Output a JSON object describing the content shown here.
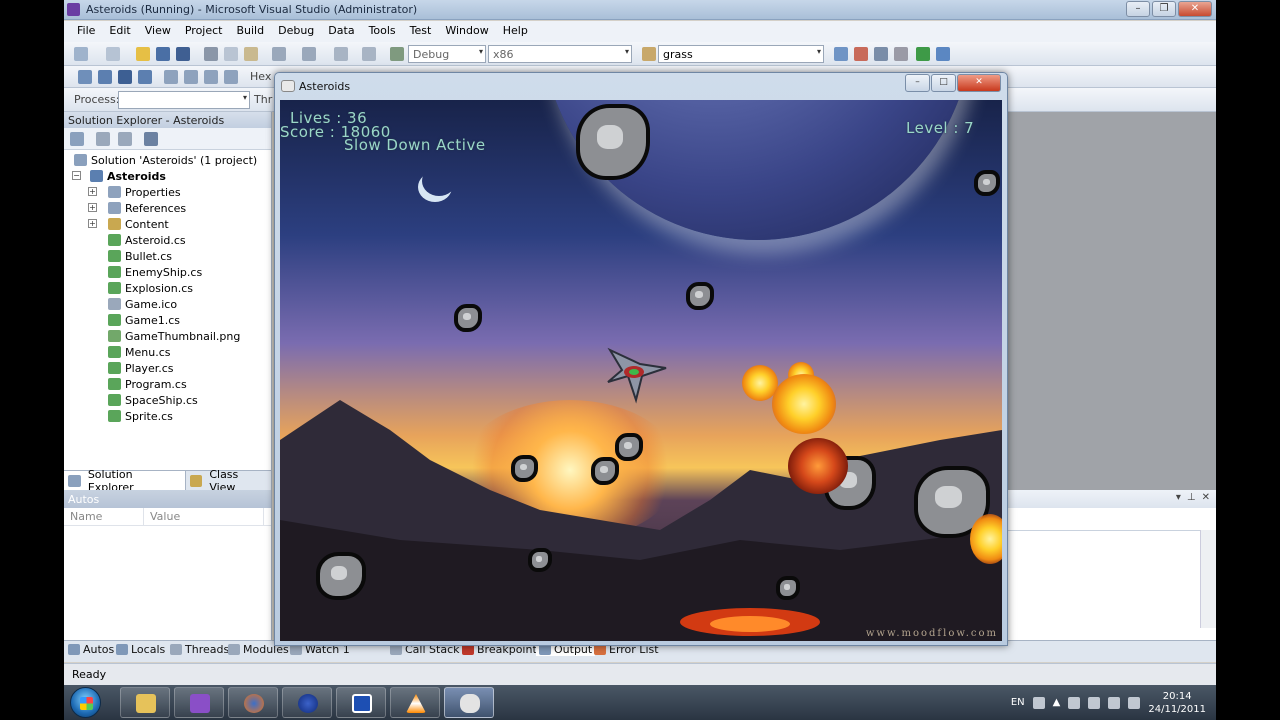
{
  "window": {
    "title": "Asteroids (Running) - Microsoft Visual Studio (Administrator)"
  },
  "menu": [
    "File",
    "Edit",
    "View",
    "Project",
    "Build",
    "Debug",
    "Data",
    "Tools",
    "Test",
    "Window",
    "Help"
  ],
  "toolbar": {
    "config": "Debug",
    "platform": "x86",
    "find": "grass",
    "hex_label": "Hex",
    "process_label": "Process:",
    "thread_label": "Thr"
  },
  "solution_explorer": {
    "title": "Solution Explorer - Asteroids",
    "solution": "Solution 'Asteroids' (1 project)",
    "project": "Asteroids",
    "items": [
      {
        "label": "Properties",
        "icon": "folder-icon"
      },
      {
        "label": "References",
        "icon": "folder-icon"
      },
      {
        "label": "Content",
        "icon": "content-icon"
      },
      {
        "label": "Asteroid.cs",
        "icon": "cs-file-icon"
      },
      {
        "label": "Bullet.cs",
        "icon": "cs-file-icon"
      },
      {
        "label": "EnemyShip.cs",
        "icon": "cs-file-icon"
      },
      {
        "label": "Explosion.cs",
        "icon": "cs-file-icon"
      },
      {
        "label": "Game.ico",
        "icon": "ico-file-icon"
      },
      {
        "label": "Game1.cs",
        "icon": "cs-file-icon"
      },
      {
        "label": "GameThumbnail.png",
        "icon": "image-file-icon"
      },
      {
        "label": "Menu.cs",
        "icon": "cs-file-icon"
      },
      {
        "label": "Player.cs",
        "icon": "cs-file-icon"
      },
      {
        "label": "Program.cs",
        "icon": "cs-file-icon"
      },
      {
        "label": "SpaceShip.cs",
        "icon": "cs-file-icon"
      },
      {
        "label": "Sprite.cs",
        "icon": "cs-file-icon"
      }
    ],
    "tabs": [
      "Solution Explorer",
      "Class View"
    ]
  },
  "autos": {
    "title": "Autos",
    "columns": [
      "Name",
      "Value"
    ]
  },
  "bottom_tabs": [
    "Autos",
    "Locals",
    "Threads",
    "Modules",
    "Watch 1",
    "Call Stack",
    "Breakpoints",
    "Output",
    "Error List"
  ],
  "status": "Ready",
  "game": {
    "title": "Asteroids",
    "lives": "Lives : 36",
    "score": "Score : 18060",
    "status_msg": "Slow Down Active",
    "level": "Level : 7",
    "watermark": "www.moodflow.com"
  },
  "taskbar": {
    "language": "EN",
    "time": "20:14",
    "date": "24/11/2011"
  }
}
